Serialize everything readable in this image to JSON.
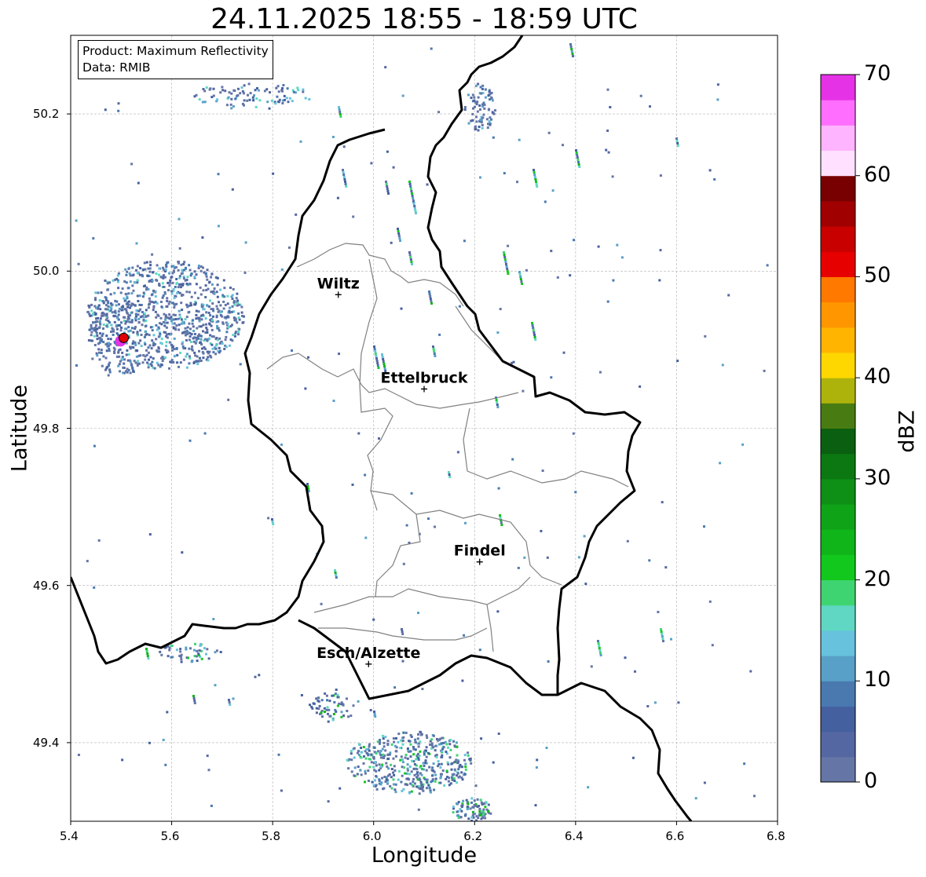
{
  "title": "24.11.2025 18:55 - 18:59 UTC",
  "info": {
    "product": "Product: Maximum Reflectivity",
    "data": "Data: RMIB"
  },
  "axes": {
    "xlabel": "Longitude",
    "ylabel": "Latitude",
    "xlim": [
      5.4,
      6.8
    ],
    "ylim": [
      49.3,
      50.3
    ],
    "xticks": [
      "5.4",
      "5.6",
      "5.8",
      "6.0",
      "6.2",
      "6.4",
      "6.6",
      "6.8"
    ],
    "yticks": [
      "49.4",
      "49.6",
      "49.8",
      "50.0",
      "50.2"
    ],
    "grid": true
  },
  "colorbar": {
    "label": "dBZ",
    "range": [
      0,
      70
    ],
    "ticks": [
      "0",
      "10",
      "20",
      "30",
      "40",
      "50",
      "60",
      "70"
    ],
    "colors": [
      "#6475a6",
      "#5567a2",
      "#44609f",
      "#4a79b0",
      "#58a0c7",
      "#66c2dd",
      "#5fd7c3",
      "#3fd472",
      "#12c81d",
      "#10b51a",
      "#0fa318",
      "#0e8f16",
      "#0b7812",
      "#0a5f10",
      "#487c12",
      "#aeb30c",
      "#ffd700",
      "#ffb400",
      "#ff9600",
      "#ff7800",
      "#e60000",
      "#c80000",
      "#a00000",
      "#780000",
      "#ffe0ff",
      "#ffb4ff",
      "#ff6eff",
      "#e632e6"
    ]
  },
  "cities": [
    {
      "name": "Wiltz",
      "lon": 5.93,
      "lat": 49.97
    },
    {
      "name": "Ettelbruck",
      "lon": 6.1,
      "lat": 49.85
    },
    {
      "name": "Findel",
      "lon": 6.21,
      "lat": 49.63
    },
    {
      "name": "Esch/Alzette",
      "lon": 5.99,
      "lat": 49.5
    }
  ],
  "radar_site": {
    "lon": 5.505,
    "lat": 49.915,
    "color": "#e00000"
  }
}
